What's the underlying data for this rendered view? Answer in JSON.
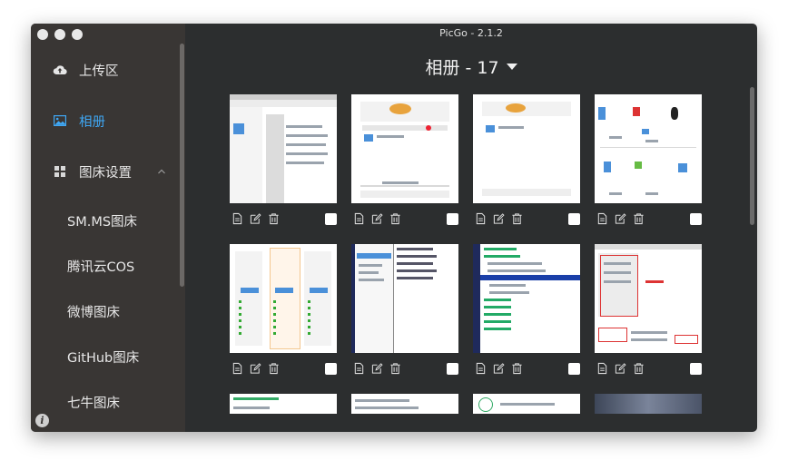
{
  "window": {
    "title": "PicGo - 2.1.2"
  },
  "sidebar": {
    "items": [
      {
        "label": "上传区",
        "icon": "cloud-upload-icon"
      },
      {
        "label": "相册",
        "icon": "image-icon",
        "active": true
      },
      {
        "label": "图床设置",
        "icon": "grid-icon",
        "expanded": true
      }
    ],
    "sub_items": [
      {
        "label": "SM.MS图床"
      },
      {
        "label": "腾讯云COS"
      },
      {
        "label": "微博图床"
      },
      {
        "label": "GitHub图床"
      },
      {
        "label": "七牛图床"
      }
    ]
  },
  "gallery": {
    "title": "相册 - 17"
  },
  "colors": {
    "sidebar_bg": "#393634",
    "main_bg": "#2c2e2f",
    "accent": "#3fa8f5"
  },
  "thumbnails": [
    {
      "row": 1,
      "kind": "file-browser"
    },
    {
      "row": 1,
      "kind": "dialog"
    },
    {
      "row": 1,
      "kind": "dialog-small"
    },
    {
      "row": 1,
      "kind": "app-cards"
    },
    {
      "row": 2,
      "kind": "pricing"
    },
    {
      "row": 2,
      "kind": "tree-view"
    },
    {
      "row": 2,
      "kind": "notes-list"
    },
    {
      "row": 2,
      "kind": "form-red"
    },
    {
      "row": 3,
      "kind": "partial"
    },
    {
      "row": 3,
      "kind": "partial"
    },
    {
      "row": 3,
      "kind": "partial"
    },
    {
      "row": 3,
      "kind": "photo"
    }
  ]
}
